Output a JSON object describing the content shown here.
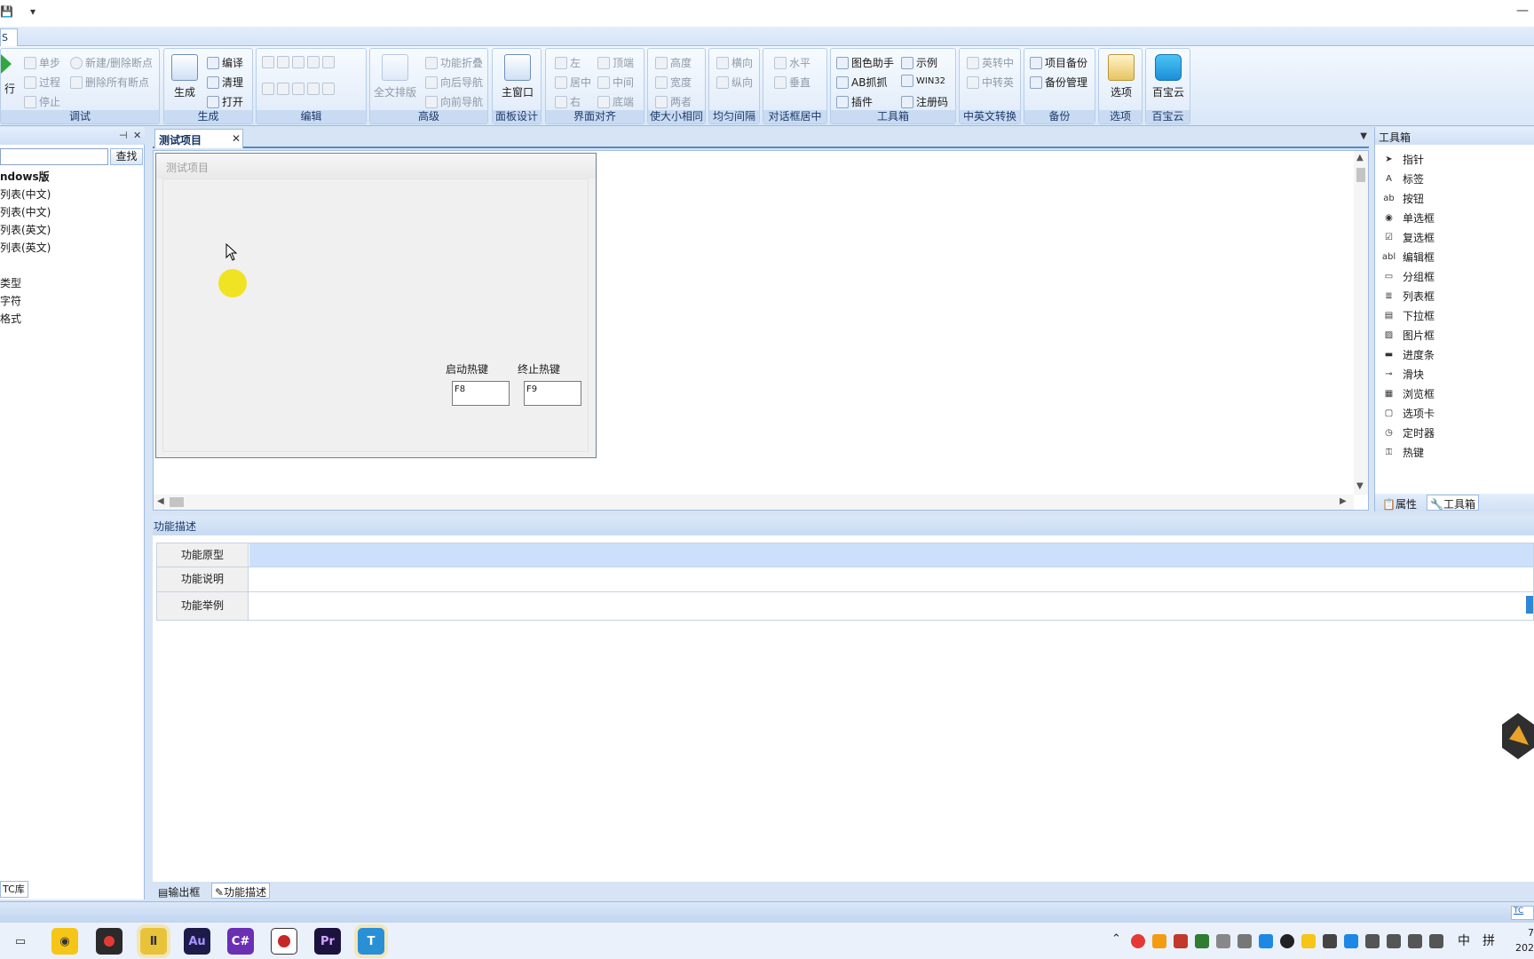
{
  "titlebar": {
    "quick_access_1": "▾",
    "minimize": "—"
  },
  "ribbon": {
    "active_tab": "S",
    "groups": {
      "debug": {
        "caption": "调试",
        "run": "行",
        "step": "单步",
        "proc": "过程",
        "stop": "停止",
        "new_bp": "新建/删除断点",
        "del_bp": "删除所有断点"
      },
      "build": {
        "caption": "生成",
        "generate": "生成",
        "compile": "编译",
        "clean": "清理",
        "open": "打开"
      },
      "edit": {
        "caption": "编辑"
      },
      "advanced": {
        "caption": "高级",
        "full_layout": "全文排版",
        "fold": "功能折叠",
        "nav_back": "向后导航",
        "nav_fwd": "向前导航"
      },
      "panel": {
        "caption": "面板设计",
        "main_window": "主窗口"
      },
      "align": {
        "caption": "界面对齐",
        "left": "左",
        "top": "顶端",
        "center": "居中",
        "middle": "中间",
        "right": "右",
        "bottom": "底端"
      },
      "size": {
        "caption": "使大小相同",
        "height": "高度",
        "width": "宽度",
        "both": "两者"
      },
      "spacing": {
        "caption": "均匀间隔",
        "horizontal": "横向",
        "vertical": "纵向"
      },
      "dialog_center": {
        "caption": "对话框居中",
        "horizontal": "水平",
        "vertical": "垂直"
      },
      "tools": {
        "caption": "工具箱",
        "color_helper": "图色助手",
        "example": "示例",
        "ab_grab": "AB抓抓",
        "win32": "WIN32",
        "plugin": "插件",
        "regcode": "注册码"
      },
      "cn_en": {
        "caption": "中英文转换",
        "en2cn": "英转中",
        "cn2en": "中转英"
      },
      "backup": {
        "caption": "备份",
        "project_backup": "项目备份",
        "backup_mgr": "备份管理"
      },
      "options": {
        "caption": "选项",
        "options": "选项"
      },
      "cloud": {
        "caption": "百宝云",
        "cloud": "百宝云"
      }
    }
  },
  "left_panel": {
    "find_button": "查找",
    "search_value": "",
    "items": [
      "ndows版",
      "列表(中文)",
      "列表(中文)",
      "列表(英文)",
      "列表(英文)",
      "类型",
      "字符",
      "格式"
    ],
    "bottom_tab": "TC库"
  },
  "document": {
    "tab_label": "测试项目",
    "form_title": "测试项目",
    "start_hotkey_label": "启动热键",
    "stop_hotkey_label": "终止热键",
    "start_hotkey_value": "F8",
    "stop_hotkey_value": "F9"
  },
  "toolbox": {
    "title": "工具箱",
    "items": [
      {
        "label": "指针",
        "icon": "pointer-icon"
      },
      {
        "label": "标签",
        "icon": "label-icon"
      },
      {
        "label": "按钮",
        "icon": "button-icon"
      },
      {
        "label": "单选框",
        "icon": "radio-icon"
      },
      {
        "label": "复选框",
        "icon": "checkbox-icon"
      },
      {
        "label": "编辑框",
        "icon": "editbox-icon"
      },
      {
        "label": "分组框",
        "icon": "groupbox-icon"
      },
      {
        "label": "列表框",
        "icon": "listbox-icon"
      },
      {
        "label": "下拉框",
        "icon": "combobox-icon"
      },
      {
        "label": "图片框",
        "icon": "picture-icon"
      },
      {
        "label": "进度条",
        "icon": "progress-icon"
      },
      {
        "label": "滑块",
        "icon": "slider-icon"
      },
      {
        "label": "浏览框",
        "icon": "browser-icon"
      },
      {
        "label": "选项卡",
        "icon": "tab-icon"
      },
      {
        "label": "定时器",
        "icon": "timer-icon"
      },
      {
        "label": "热键",
        "icon": "hotkey-icon"
      }
    ],
    "tab_properties": "属性",
    "tab_toolbox": "工具箱"
  },
  "function_desc": {
    "title": "功能描述",
    "rows": [
      "功能原型",
      "功能说明",
      "功能举例"
    ]
  },
  "bottom_tabs": {
    "output": "输出框",
    "func_desc": "功能描述"
  },
  "statusbar": {
    "right_text": "TC"
  },
  "taskbar": {
    "apps": [
      "Au",
      "C#",
      "Pr"
    ],
    "ime": "中",
    "layout": "拼",
    "clock_line1": "7",
    "clock_line2": "202"
  }
}
